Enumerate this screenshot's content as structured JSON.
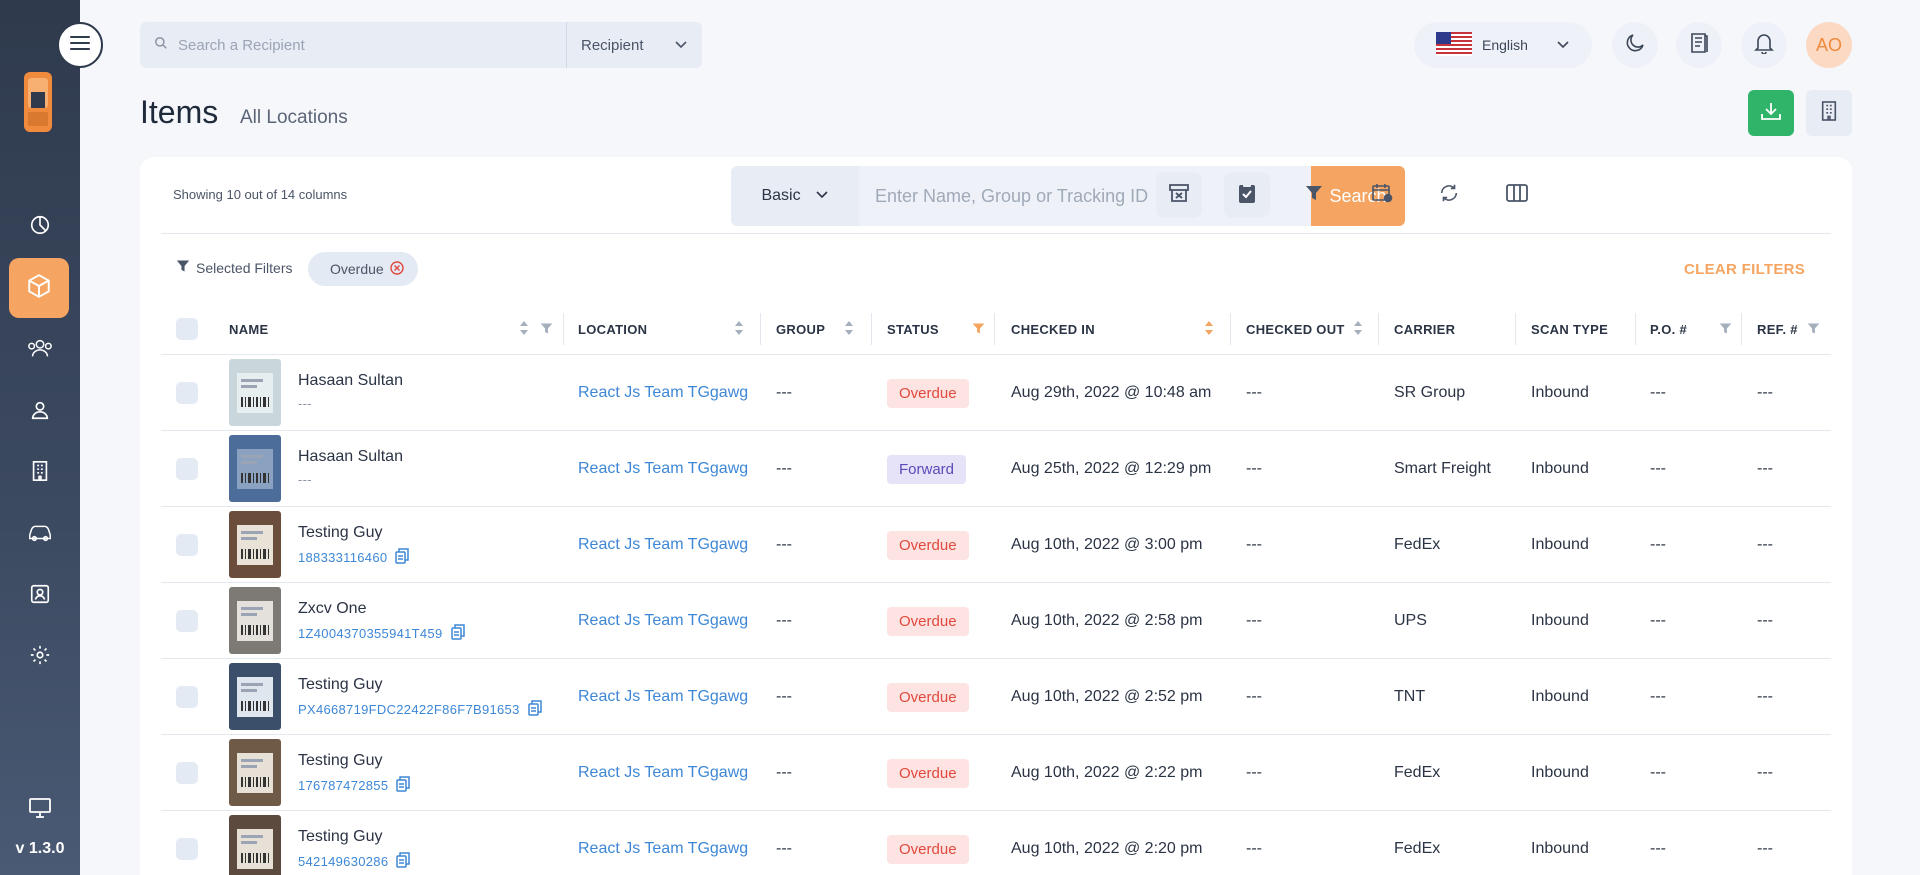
{
  "app": {
    "version": "v 1.3.0",
    "colors": {
      "accent": "#f5a561",
      "link": "#3d87d6",
      "sidebar": "#2f3a4d",
      "download": "#2fb46a",
      "overdue": "#e0483d",
      "forward": "#5a4ab8"
    }
  },
  "topbar": {
    "search_placeholder": "Search a Recipient",
    "search_type": "Recipient",
    "language": "English",
    "avatar_initials": "AO"
  },
  "page": {
    "title": "Items",
    "subtitle": "All Locations"
  },
  "toolbar": {
    "columns_note": "Showing 10 out of 14 columns",
    "search_mode": "Basic",
    "search_placeholder": "Enter Name, Group or Tracking ID",
    "search_button": "Search"
  },
  "filters": {
    "label": "Selected Filters",
    "chips": [
      "Overdue"
    ],
    "clear_label": "CLEAR FILTERS"
  },
  "table": {
    "headers": {
      "name": "NAME",
      "location": "LOCATION",
      "group": "GROUP",
      "status": "STATUS",
      "checked_in": "CHECKED IN",
      "checked_out": "CHECKED OUT",
      "carrier": "CARRIER",
      "scan_type": "SCAN TYPE",
      "po": "P.O. #",
      "ref": "REF. #"
    },
    "rows": [
      {
        "name": "Hasaan Sultan",
        "tracking": "---",
        "has_tracking": false,
        "location": "React Js Team TGgawg",
        "group": "---",
        "status": "Overdue",
        "checked_in": "Aug 29th, 2022 @ 10:48 am",
        "checked_out": "---",
        "carrier": "SR Group",
        "scan_type": "Inbound",
        "po": "---",
        "ref": "---"
      },
      {
        "name": "Hasaan Sultan",
        "tracking": "---",
        "has_tracking": false,
        "location": "React Js Team TGgawg",
        "group": "---",
        "status": "Forward",
        "checked_in": "Aug 25th, 2022 @ 12:29 pm",
        "checked_out": "---",
        "carrier": "Smart Freight",
        "scan_type": "Inbound",
        "po": "---",
        "ref": "---"
      },
      {
        "name": "Testing Guy",
        "tracking": "188333116460",
        "has_tracking": true,
        "location": "React Js Team TGgawg",
        "group": "---",
        "status": "Overdue",
        "checked_in": "Aug 10th, 2022 @ 3:00 pm",
        "checked_out": "---",
        "carrier": "FedEx",
        "scan_type": "Inbound",
        "po": "---",
        "ref": "---"
      },
      {
        "name": "Zxcv One",
        "tracking": "1Z4004370355941T459",
        "has_tracking": true,
        "location": "React Js Team TGgawg",
        "group": "---",
        "status": "Overdue",
        "checked_in": "Aug 10th, 2022 @ 2:58 pm",
        "checked_out": "---",
        "carrier": "UPS",
        "scan_type": "Inbound",
        "po": "---",
        "ref": "---"
      },
      {
        "name": "Testing Guy",
        "tracking": "PX4668719FDC22422F86F7B91653",
        "has_tracking": true,
        "location": "React Js Team TGgawg",
        "group": "---",
        "status": "Overdue",
        "checked_in": "Aug 10th, 2022 @ 2:52 pm",
        "checked_out": "---",
        "carrier": "TNT",
        "scan_type": "Inbound",
        "po": "---",
        "ref": "---"
      },
      {
        "name": "Testing Guy",
        "tracking": "176787472855",
        "has_tracking": true,
        "location": "React Js Team TGgawg",
        "group": "---",
        "status": "Overdue",
        "checked_in": "Aug 10th, 2022 @ 2:22 pm",
        "checked_out": "---",
        "carrier": "FedEx",
        "scan_type": "Inbound",
        "po": "---",
        "ref": "---"
      },
      {
        "name": "Testing Guy",
        "tracking": "542149630286",
        "has_tracking": true,
        "location": "React Js Team TGgawg",
        "group": "---",
        "status": "Overdue",
        "checked_in": "Aug 10th, 2022 @ 2:20 pm",
        "checked_out": "---",
        "carrier": "FedEx",
        "scan_type": "Inbound",
        "po": "---",
        "ref": "---"
      }
    ]
  }
}
